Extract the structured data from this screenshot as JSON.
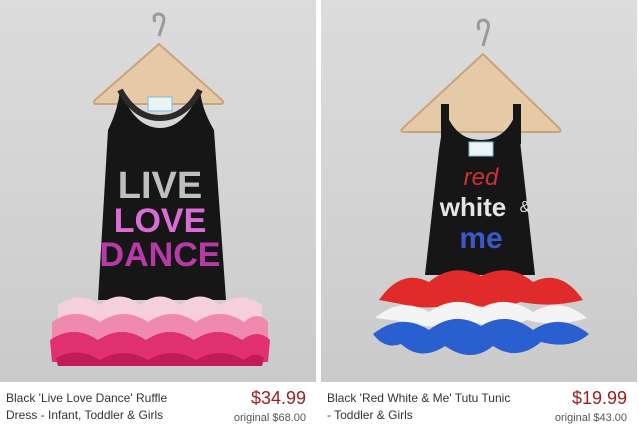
{
  "products": [
    {
      "name": "Black 'Live Love Dance' Ruffle Dress - Infant, Toddler & Girls",
      "price": "$34.99",
      "original_label": "original",
      "original_price": "$68.00",
      "graphic_lines": [
        "LIVE",
        "LOVE",
        "DANCE"
      ],
      "colors": {
        "dress": "#141414",
        "ruffle_top": "#f4c3d2",
        "ruffle_mid": "#ee7fa6",
        "ruffle_bottom": "#e0296b"
      }
    },
    {
      "name": "Black 'Red White & Me' Tutu Tunic - Toddler & Girls",
      "price": "$19.99",
      "original_label": "original",
      "original_price": "$43.00",
      "graphic_lines": [
        "red",
        "white",
        "&",
        "me"
      ],
      "colors": {
        "dress": "#141414",
        "tutu_red": "#e12a2a",
        "tutu_white": "#f4f4f4",
        "tutu_blue": "#2a5fd0"
      }
    }
  ]
}
